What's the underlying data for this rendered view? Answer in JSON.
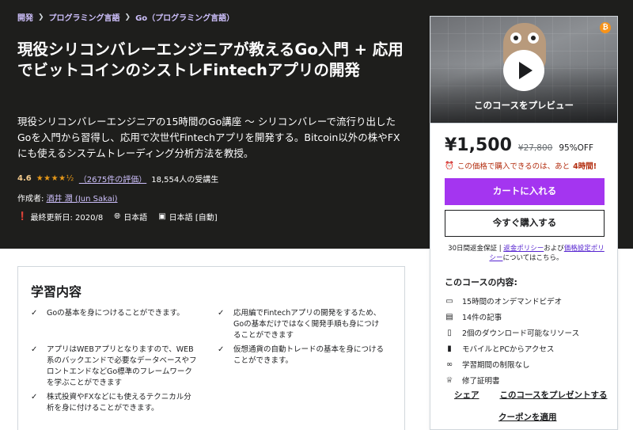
{
  "breadcrumb": [
    "開発",
    "プログラミング言語",
    "Go（プログラミング言語）"
  ],
  "course": {
    "title": "現役シリコンバレーエンジニアが教えるGo入門 + 応用でビットコインのシストレFintechアプリの開発",
    "subtitle": "現役シリコンバレーエンジニアの15時間のGo講座 〜 シリコンバレーで流行り出したGoを入門から習得し、応用で次世代Fintechアプリを開発する。Bitcoin以外の株やFXにも使えるシステムトレーディング分析方法を教授。",
    "rating": "4.6",
    "stars": "★★★★½",
    "reviews": "（2675件の評価）",
    "students": "18,554人の受講生",
    "author_label": "作成者: ",
    "author": "酒井 潤 (Jun Sakai)",
    "updated": "最終更新日: 2020/8",
    "language": "日本語",
    "captions": "日本語 [自動]"
  },
  "sidebar": {
    "preview_label": "このコースをプレビュー",
    "price": "¥1,500",
    "original_price": "¥27,800",
    "discount": "95%OFF",
    "timer_text": "この価格で購入できるのは、あと",
    "timer_remaining": "4時間!",
    "add_to_cart": "カートに入れる",
    "buy_now": "今すぐ購入する",
    "guarantee_prefix": "30日間返金保証 | ",
    "refund_policy": "返金ポリシー",
    "guarantee_mid": "および",
    "pricing_policy": "価格設定ポリシー",
    "guarantee_suffix": "についてはこちら。",
    "includes_title": "このコースの内容:",
    "includes": [
      {
        "icon": "video-icon",
        "label": "15時間のオンデマンドビデオ"
      },
      {
        "icon": "article-icon",
        "label": "14件の記事"
      },
      {
        "icon": "download-icon",
        "label": "2個のダウンロード可能なリソース"
      },
      {
        "icon": "mobile-icon",
        "label": "モバイルとPCからアクセス"
      },
      {
        "icon": "infinity-icon",
        "label": "学習期間の制限なし"
      },
      {
        "icon": "trophy-icon",
        "label": "修了証明書"
      }
    ],
    "share": "シェア",
    "gift": "このコースをプレゼントする",
    "coupon": "クーポンを適用"
  },
  "learn": {
    "title": "学習内容",
    "items": [
      "Goの基本を身につけることができます。",
      "応用編でFintechアプリの開発をするため、Goの基本だけではなく開発手順も身につけることができます",
      "アプリはWEBアプリとなりますので、WEB系のバックエンドで必要なデータベースやフロントエンドなどGo標準のフレームワークを学ぶことができます",
      "仮想通貨の自動トレードの基本を身につけることができます。",
      "株式投資やFXなどにも使えるテクニカル分析を身に付けることができます。"
    ]
  },
  "colors": {
    "hero_bg": "#1e1e1c",
    "accent_purple": "#a435f0",
    "link_purple": "#cec0fc",
    "rating_orange": "#e59819",
    "timer_red": "#b32d0f"
  }
}
